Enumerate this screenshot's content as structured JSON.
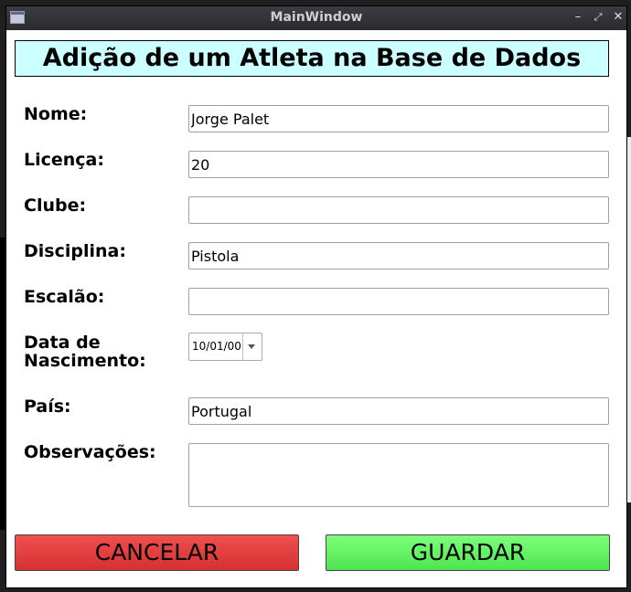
{
  "window": {
    "title": "MainWindow"
  },
  "header": {
    "title": "Adição de um Atleta na Base de Dados"
  },
  "form": {
    "nome": {
      "label": "Nome:",
      "value": "Jorge Palet"
    },
    "licenca": {
      "label": "Licença:",
      "value": "20"
    },
    "clube": {
      "label": "Clube:",
      "value": ""
    },
    "disciplina": {
      "label": "Disciplina:",
      "value": "Pistola"
    },
    "escalao": {
      "label": "Escalão:",
      "value": ""
    },
    "nascimento": {
      "label_line1": "Data de",
      "label_line2": "Nascimento:",
      "value": "10/01/00"
    },
    "pais": {
      "label": "País:",
      "value": "Portugal"
    },
    "observacoes": {
      "label": "Observações:",
      "value": ""
    }
  },
  "buttons": {
    "cancel": "CANCELAR",
    "save": "GUARDAR"
  },
  "colors": {
    "header_bg": "#ccffff",
    "cancel_bg": "#e04040",
    "save_bg": "#66ff66",
    "titlebar_bg": "#333339"
  }
}
